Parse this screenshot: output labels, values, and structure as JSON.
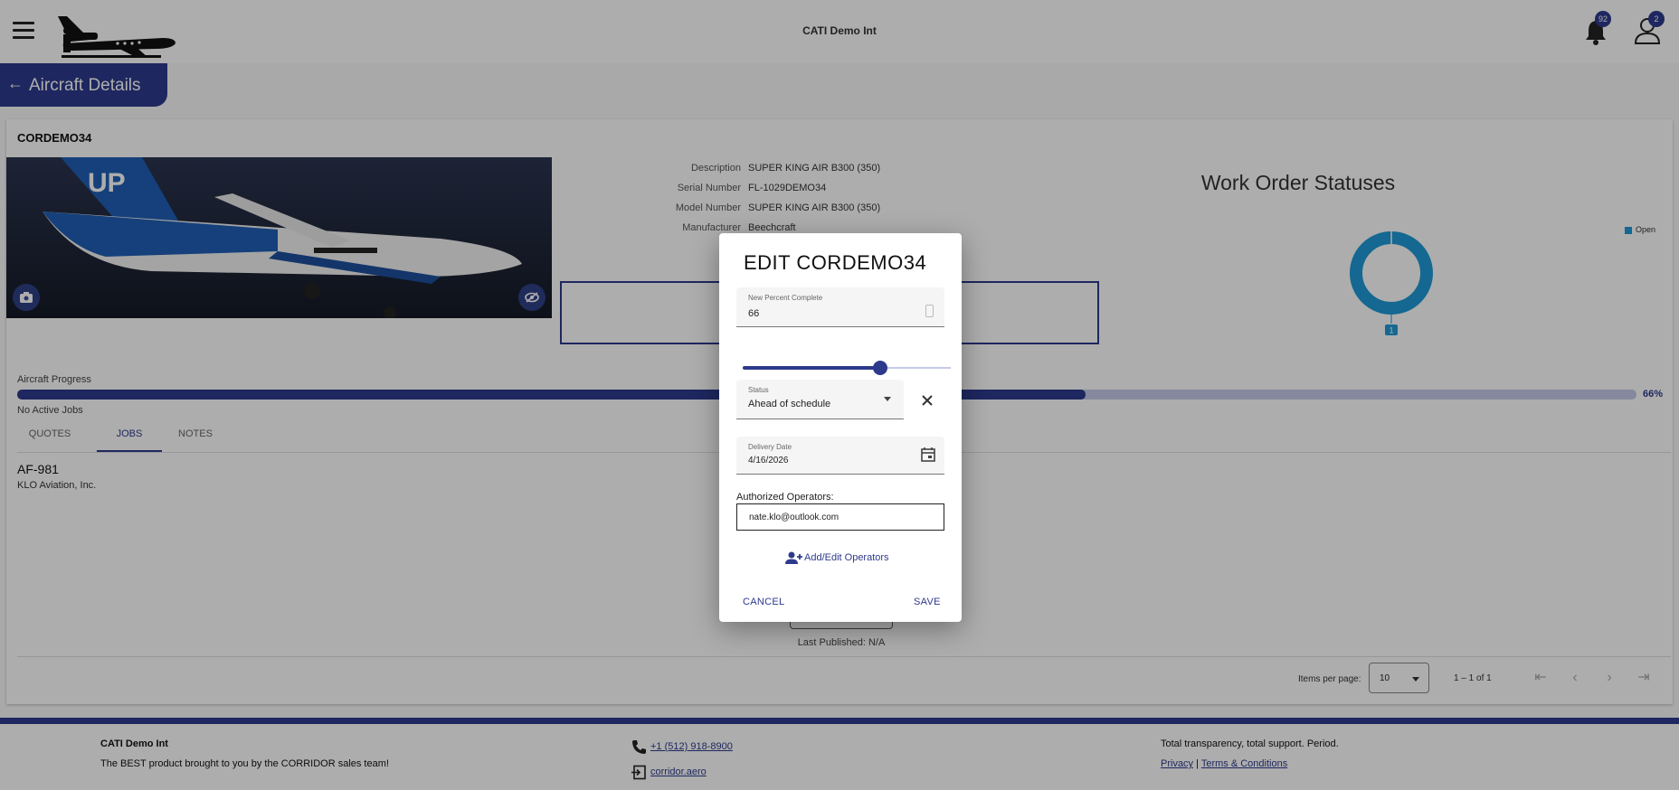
{
  "header": {
    "app_title": "CATI Demo Int",
    "notifications_count": "92",
    "user_badge_count": "2",
    "page_title": "Aircraft Details"
  },
  "aircraft": {
    "name": "CORDEMO34",
    "details": [
      {
        "label": "Description",
        "value": "SUPER KING AIR B300 (350)"
      },
      {
        "label": "Serial Number",
        "value": "FL-1029DEMO34"
      },
      {
        "label": "Model Number",
        "value": "SUPER KING AIR B300 (350)"
      },
      {
        "label": "Manufacturer",
        "value": "Beechcraft"
      }
    ],
    "progress_label": "Aircraft Progress",
    "progress_value": 66,
    "progress_text": "66%",
    "no_jobs_text": "No Active Jobs"
  },
  "chart": {
    "title": "Work Order Statuses",
    "legend_label": "Open",
    "color": "#1e9ad6"
  },
  "chart_data": {
    "type": "pie",
    "title": "Work Order Statuses",
    "categories": [
      "Open"
    ],
    "values": [
      1
    ],
    "legend_position": "top-right"
  },
  "tabs": [
    {
      "label": "QUOTES",
      "active": false
    },
    {
      "label": "JOBS",
      "active": true
    },
    {
      "label": "NOTES",
      "active": false
    }
  ],
  "jobs": [
    {
      "id": "AF-981",
      "org": "KLO Aviation, Inc."
    }
  ],
  "publish": {
    "last_published": "Last Published: N/A"
  },
  "pager": {
    "items_per_page_label": "Items per page:",
    "items_per_page_value": "10",
    "range": "1 – 1 of 1"
  },
  "footer": {
    "company": "CATI Demo Int",
    "tagline": "The BEST product brought to you by the CORRIDOR sales team!",
    "phone": "+1 (512) 918-8900",
    "website": "corridor.aero",
    "slogan": "Total transparency, total support. Period.",
    "privacy": "Privacy",
    "separator": "|",
    "terms": "Terms & Conditions"
  },
  "dialog": {
    "title": "EDIT CORDEMO34",
    "percent_label": "New Percent Complete",
    "percent_value": "66",
    "slider_value": 66,
    "status_label": "Status",
    "status_value": "Ahead of schedule",
    "delivery_label": "Delivery Date",
    "delivery_value": "4/16/2026",
    "operators_label": "Authorized Operators:",
    "operators_value": "nate.klo@outlook.com",
    "add_operators": "Add/Edit Operators",
    "cancel": "CANCEL",
    "save": "SAVE"
  },
  "colors": {
    "primary": "#2d3a8c",
    "chart_open": "#1e9ad6"
  }
}
